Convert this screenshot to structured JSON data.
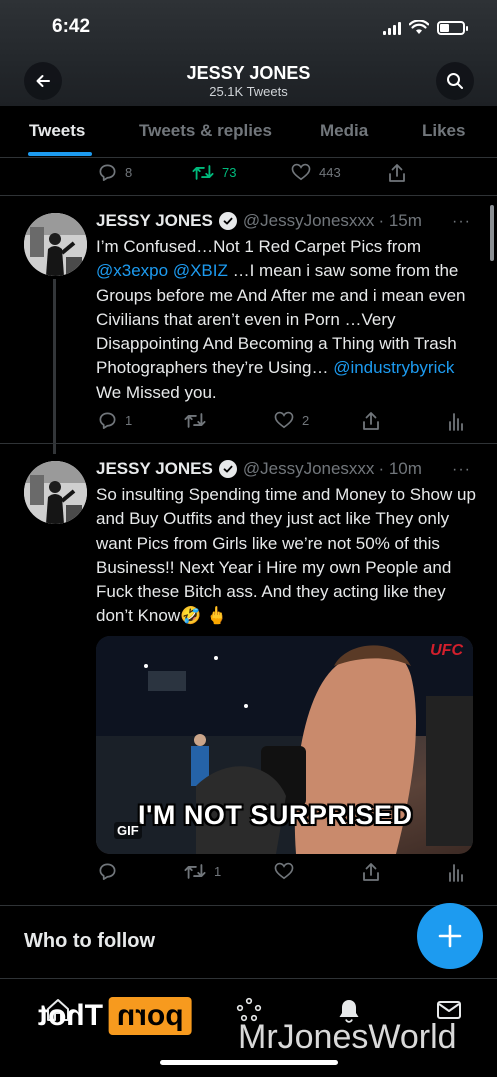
{
  "status_bar": {
    "time": "6:42"
  },
  "profile": {
    "name": "JESSY JONES",
    "tweet_count": "25.1K Tweets"
  },
  "tabs": [
    {
      "label": "Tweets",
      "active": true
    },
    {
      "label": "Tweets & replies",
      "active": false
    },
    {
      "label": "Media",
      "active": false
    },
    {
      "label": "Likes",
      "active": false
    }
  ],
  "tweet0": {
    "replies": "8",
    "retweets": "73",
    "likes": "443"
  },
  "tweet1": {
    "name": "JESSY JONES",
    "handle": "@JessyJonesxxx",
    "time": "· 15m",
    "more": "···",
    "text_parts": {
      "a": "I’m Confused…Not 1 Red Carpet Pics from ",
      "m1": "@x3expo",
      "b": " ",
      "m2": "@XBIZ",
      "c": " …I mean i saw some from the Groups before me And After me and i mean even Civilians that aren’t even in Porn …Very Disappointing And Becoming a Thing with Trash Photographers they’re Using… ",
      "m3": "@industrybyrick",
      "d": " We Missed you."
    },
    "replies": "1",
    "retweets": "",
    "likes": "2"
  },
  "tweet2": {
    "name": "JESSY JONES",
    "handle": "@JessyJonesxxx",
    "time": "· 10m",
    "more": "···",
    "text": "So insulting Spending time and Money to Show up and Buy Outfits and they just act like They only want Pics from Girls like we’re not 50% of this Business!! Next Year i Hire my own People and Fuck these Bitch ass. And they acting like they don’t Know🤣 🖕",
    "gif": {
      "caption": "I'M NOT SURPRISED",
      "badge": "GIF",
      "logo": "UFC"
    },
    "replies": "",
    "retweets": "1",
    "likes": ""
  },
  "who_to_follow": {
    "title": "Who to follow"
  },
  "watermarks": {
    "logo_box": "porn",
    "logo_text": "Thot",
    "text": "MrJonesWorld"
  },
  "colors": {
    "accent": "#1d9bf0",
    "retweet_active": "#00ba7c",
    "muted": "#71767b"
  }
}
